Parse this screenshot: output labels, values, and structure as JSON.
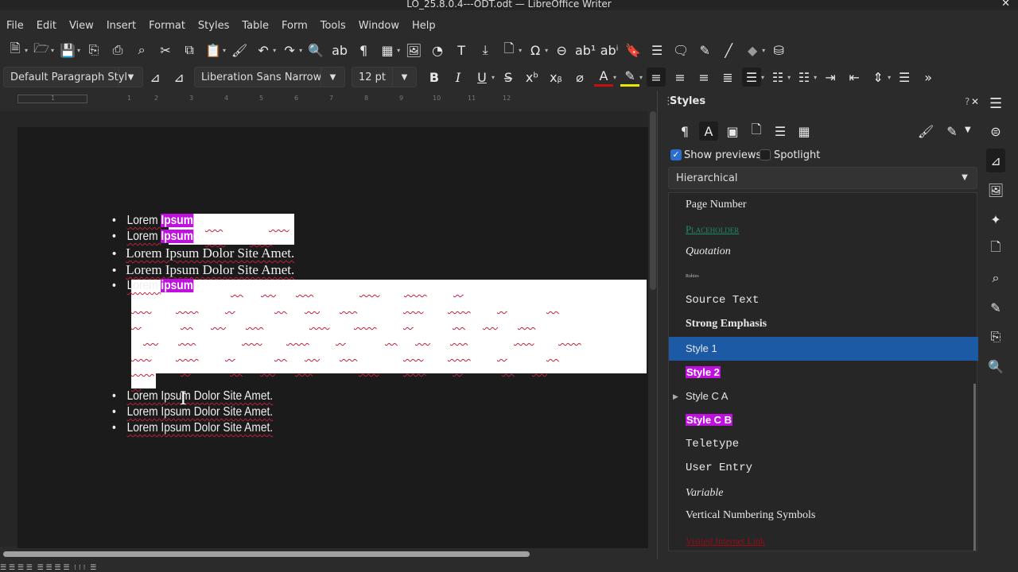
{
  "window": {
    "title": "LO_25.8.0.4---ODT.odt — LibreOffice Writer",
    "close": "✕"
  },
  "menu": [
    "File",
    "Edit",
    "View",
    "Insert",
    "Format",
    "Styles",
    "Table",
    "Form",
    "Tools",
    "Window",
    "Help"
  ],
  "toolbar": {
    "para_style": "Default Paragraph Styl",
    "font_name": "Liberation Sans Narrow",
    "font_size": "12 pt",
    "bold": "B",
    "italic": "I",
    "underline": "U",
    "overflow": "»"
  },
  "ruler": {
    "ticks": [
      "1",
      "1",
      "2",
      "3",
      "4",
      "5",
      "6",
      "7",
      "8",
      "9",
      "10",
      "11",
      "12"
    ]
  },
  "document": {
    "items": [
      {
        "a": "Lorem ",
        "b": "Ipsum"
      },
      {
        "a": "Lorem ",
        "b": "Ipsum"
      },
      {
        "text": "Lorem Ipsum Dolor Site Amet."
      },
      {
        "text": "Lorem Ipsum Dolor Site Amet."
      },
      {
        "a": "Lorem ",
        "b": "ipsum"
      },
      {
        "text": "Lorem Ipsum Dolor Site Amet."
      },
      {
        "text": "Lorem Ipsum Dolor Site Amet."
      },
      {
        "text": "Lorem Ipsum Dolor Site Amet."
      }
    ],
    "bullet": "•"
  },
  "styles_panel": {
    "title": "Styles",
    "help": "?",
    "close": "✕",
    "show_previews": "Show previews",
    "show_previews_checked": true,
    "spotlight": "Spotlight",
    "spotlight_checked": false,
    "filter": "Hierarchical",
    "items": [
      "Page Number",
      "Placeholder",
      "Quotation",
      "Rubies",
      "Source Text",
      "Strong Emphasis",
      "Style 1",
      "Style 2",
      "Style C A",
      "Style C B",
      "Teletype",
      "User Entry",
      "Variable",
      "Vertical Numbering Symbols",
      "Visited Internet Link"
    ],
    "selected": "Style 1"
  },
  "colors": {
    "selection": "#1c5aa6",
    "highlight": "#c010e0",
    "spell": "#c0203a",
    "placeholder": "#1f8a6a",
    "visited": "#9a0a14"
  }
}
